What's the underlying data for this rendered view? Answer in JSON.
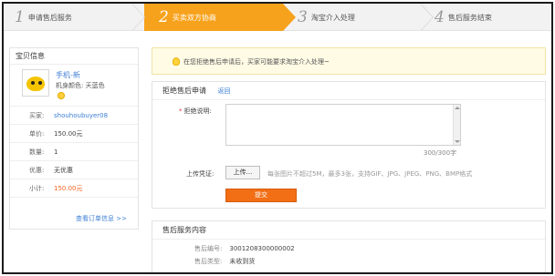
{
  "steps": [
    {
      "num": "1",
      "label": "申请售后服务"
    },
    {
      "num": "2",
      "label": "买卖双方协商"
    },
    {
      "num": "3",
      "label": "淘宝介入处理"
    },
    {
      "num": "4",
      "label": "售后服务结束"
    }
  ],
  "item_info": {
    "title": "宝贝信息",
    "product_name": "手机-新",
    "product_attr": "机身颜色: 天蓝色",
    "rows": [
      {
        "key": "买家:",
        "value": "shouhoubuyer08"
      },
      {
        "key": "单价:",
        "value": "150.00元"
      },
      {
        "key": "数量:",
        "value": "1"
      },
      {
        "key": "优惠:",
        "value": "无优惠"
      },
      {
        "key": "小计:",
        "value": "150.00元"
      }
    ],
    "view_order": "查看订单信息 >>"
  },
  "notice": {
    "text": "在您拒绝售后申请后，买家可能要求淘宝介入处理~"
  },
  "refuse_form": {
    "title": "拒绝售后申请",
    "back_link": "返回",
    "reason_label": "拒绝说明:",
    "reason_required": "*",
    "reason_value": "",
    "counter": "300/300字",
    "upload_label": "上传凭证:",
    "upload_button": "上传...",
    "upload_hint": "每张图片不超过5M，最多3张，支持GIF、JPG、JPEG、PNG、BMP格式",
    "submit_label": "提交"
  },
  "after_sale": {
    "title": "售后服务内容",
    "rows": [
      {
        "key": "售后编号:",
        "value": "3001208300000002"
      },
      {
        "key": "售后类型:",
        "value": "未收到货"
      }
    ]
  },
  "colors": {
    "accent_orange": "#f7a21c",
    "submit_orange": "#f26f16",
    "link_blue": "#3e7fd4",
    "price_orange": "#f26522"
  }
}
